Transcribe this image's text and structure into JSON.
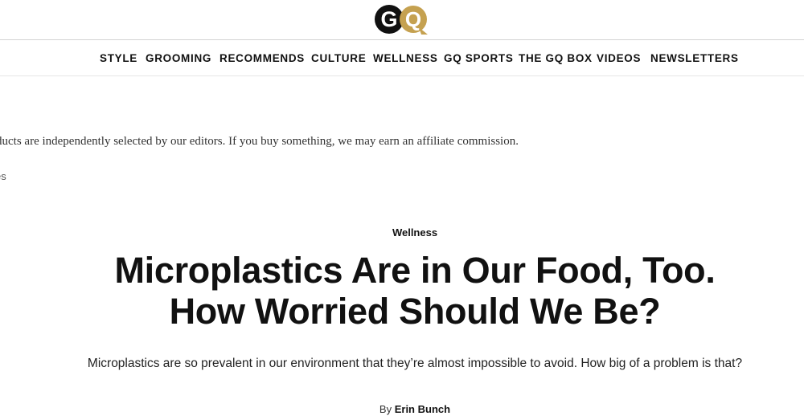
{
  "brand": {
    "logo_text": "GQ",
    "colors": {
      "g": "#111111",
      "q": "#c5a150"
    }
  },
  "nav": {
    "items": [
      {
        "label": "STYLE"
      },
      {
        "label": "GROOMING"
      },
      {
        "label": "RECOMMENDS"
      },
      {
        "label": "CULTURE"
      },
      {
        "label": "WELLNESS"
      },
      {
        "label": "GQ SPORTS"
      },
      {
        "label": "THE GQ BOX"
      },
      {
        "label": "VIDEOS"
      },
      {
        "label": "NEWSLETTERS"
      }
    ]
  },
  "disclaimer": "ducts are independently selected by our editors. If you buy something, we may earn an affiliate commission.",
  "breadcrumb_fragment": "es",
  "article": {
    "rubric": "Wellness",
    "headline_line1": "Microplastics Are in Our Food, Too.",
    "headline_line2": "How Worried Should We Be?",
    "dek": "Microplastics are so prevalent in our environment that they’re almost impossible to avoid. How big of a problem is that?",
    "byline_prefix": "By",
    "author": "Erin Bunch"
  }
}
